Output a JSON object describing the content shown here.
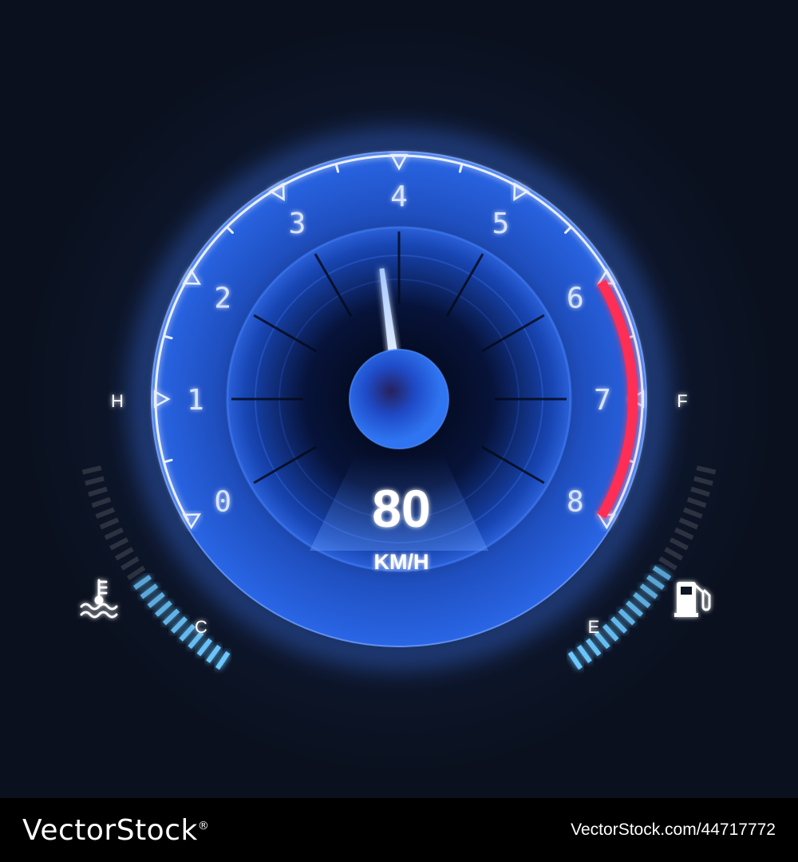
{
  "gauge": {
    "type": "tachometer",
    "scale": {
      "min": 0,
      "max": 8,
      "major_labels": [
        "0",
        "1",
        "2",
        "3",
        "4",
        "5",
        "6",
        "7",
        "8"
      ]
    },
    "needle_value": 3.75,
    "redline_start": 6,
    "speed_value": "80",
    "speed_unit": "KM/H"
  },
  "temperature_gauge": {
    "high_label": "H",
    "low_label": "C",
    "icon": "engine-coolant-icon",
    "level": 0.5
  },
  "fuel_gauge": {
    "full_label": "F",
    "empty_label": "E",
    "icon": "fuel-pump-icon",
    "level": 0.55
  },
  "colors": {
    "background": "#0b1220",
    "dial": "#1f55c8",
    "glow": "#3f7dff",
    "redline": "#ff2d55",
    "bar_active": "#6cc8ff",
    "bar_inactive": "#3a3f4a",
    "text": "#ffffff"
  },
  "footer": {
    "brand": "VectorStock",
    "registered": "®",
    "image_id": "VectorStock.com/44717772"
  }
}
